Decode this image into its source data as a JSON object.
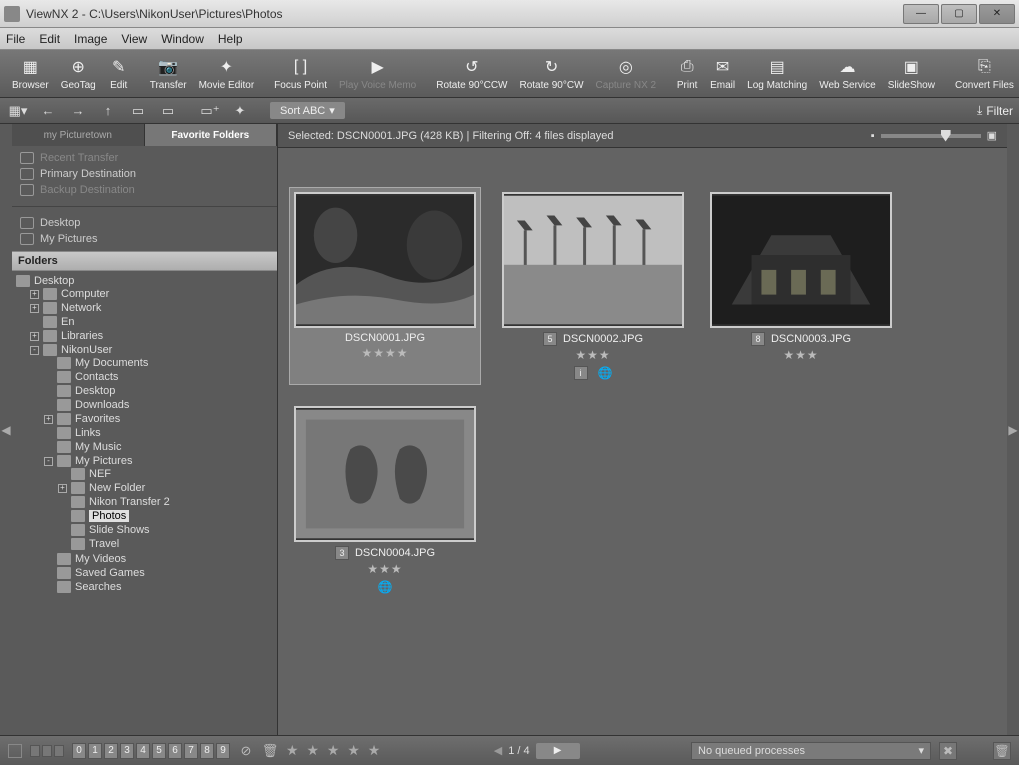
{
  "window": {
    "title": "ViewNX 2 - C:\\Users\\NikonUser\\Pictures\\Photos"
  },
  "menu": [
    "File",
    "Edit",
    "Image",
    "View",
    "Window",
    "Help"
  ],
  "toolbar": [
    {
      "label": "Browser",
      "icon": "▦"
    },
    {
      "label": "GeoTag",
      "icon": "⊕"
    },
    {
      "label": "Edit",
      "icon": "✎"
    },
    {
      "sep": true
    },
    {
      "label": "Transfer",
      "icon": "📷"
    },
    {
      "label": "Movie Editor",
      "icon": "✦"
    },
    {
      "sep": true
    },
    {
      "label": "Focus Point",
      "icon": "[ ]"
    },
    {
      "label": "Play Voice Memo",
      "icon": "▶",
      "dim": true
    },
    {
      "sep": true
    },
    {
      "label": "Rotate 90°CCW",
      "icon": "↺"
    },
    {
      "label": "Rotate 90°CW",
      "icon": "↻"
    },
    {
      "label": "Capture NX 2",
      "icon": "◎",
      "dim": true
    },
    {
      "sep": true
    },
    {
      "label": "Print",
      "icon": "⎙"
    },
    {
      "label": "Email",
      "icon": "✉"
    },
    {
      "label": "Log Matching",
      "icon": "▤"
    },
    {
      "label": "Web Service",
      "icon": "☁"
    },
    {
      "label": "SlideShow",
      "icon": "▣"
    },
    {
      "sep": true
    },
    {
      "label": "Convert Files",
      "icon": "⎘"
    }
  ],
  "toolbar2": {
    "sort_label": "Sort ABC",
    "filter_label": "Filter"
  },
  "side_tabs": {
    "inactive": "my Picturetown",
    "active": "Favorite Folders"
  },
  "destinations": [
    {
      "label": "Recent Transfer",
      "dim": true
    },
    {
      "label": "Primary Destination",
      "dim": false
    },
    {
      "label": "Backup Destination",
      "dim": true
    }
  ],
  "quick_folders": [
    "Desktop",
    "My Pictures"
  ],
  "folders_header": "Folders",
  "tree": {
    "root": "Desktop",
    "children": [
      {
        "exp": "+",
        "label": "Computer"
      },
      {
        "exp": "+",
        "label": "Network"
      },
      {
        "exp": "",
        "label": "En"
      },
      {
        "exp": "+",
        "label": "Libraries"
      },
      {
        "exp": "-",
        "label": "NikonUser",
        "children": [
          {
            "exp": "",
            "label": "My Documents"
          },
          {
            "exp": "",
            "label": "Contacts"
          },
          {
            "exp": "",
            "label": "Desktop"
          },
          {
            "exp": "",
            "label": "Downloads"
          },
          {
            "exp": "+",
            "label": "Favorites"
          },
          {
            "exp": "",
            "label": "Links"
          },
          {
            "exp": "",
            "label": "My Music"
          },
          {
            "exp": "-",
            "label": "My Pictures",
            "children": [
              {
                "exp": "",
                "label": "NEF"
              },
              {
                "exp": "+",
                "label": "New Folder"
              },
              {
                "exp": "",
                "label": "Nikon Transfer 2"
              },
              {
                "exp": "",
                "label": "Photos",
                "selected": true
              },
              {
                "exp": "",
                "label": "Slide Shows"
              },
              {
                "exp": "",
                "label": "Travel"
              }
            ]
          },
          {
            "exp": "",
            "label": "My Videos"
          },
          {
            "exp": "",
            "label": "Saved Games"
          },
          {
            "exp": "",
            "label": "Searches"
          }
        ]
      }
    ]
  },
  "status": "Selected: DSCN0001.JPG (428 KB) | Filtering Off: 4 files displayed",
  "thumbs": [
    {
      "name": "DSCN0001.JPG",
      "stars": "★★★★",
      "badge": "",
      "selected": true,
      "info": false,
      "globe": false
    },
    {
      "name": "DSCN0002.JPG",
      "stars": "★★★",
      "badge": "5",
      "selected": false,
      "info": true,
      "globe": true
    },
    {
      "name": "DSCN0003.JPG",
      "stars": "★★★",
      "badge": "8",
      "selected": false,
      "info": false,
      "globe": false
    },
    {
      "name": "DSCN0004.JPG",
      "stars": "★★★",
      "badge": "3",
      "selected": false,
      "info": false,
      "globe": true
    }
  ],
  "bottom": {
    "numbers": [
      "0",
      "1",
      "2",
      "3",
      "4",
      "5",
      "6",
      "7",
      "8",
      "9"
    ],
    "stars": "★ ★ ★ ★ ★",
    "page": "1 / 4",
    "queue": "No queued processes"
  }
}
